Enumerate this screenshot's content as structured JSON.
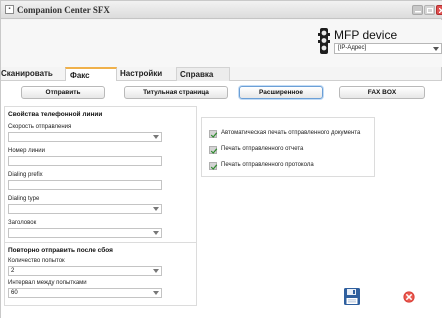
{
  "window": {
    "title": "Companion Center SFX"
  },
  "header": {
    "device_title": "MFP device",
    "ip_select_value": "[IP-Адрес]"
  },
  "tabs": [
    {
      "label": "Сканировать"
    },
    {
      "label": "Факс"
    },
    {
      "label": "Настройки"
    },
    {
      "label": "Справка"
    }
  ],
  "actions": {
    "send": "Отправить",
    "cover_page": "Титульная страница",
    "advanced": "Расширенное",
    "fax_box": "FAX BOX"
  },
  "line_props": {
    "title": "Свойства телефонной линии",
    "speed_label": "Скорость отправления",
    "speed_value": "",
    "line_number_label": "Номер линии",
    "line_number_value": "",
    "dialing_prefix_label": "Dialing prefix",
    "dialing_prefix_value": "",
    "dialing_type_label": "Dialing type",
    "dialing_type_value": "",
    "header_label": "Заголовок",
    "header_value": ""
  },
  "retry": {
    "title": "Повторно отправить после сбоя",
    "attempts_label": "Количество попыток",
    "attempts_value": "2",
    "interval_label": "Интервал между попытками",
    "interval_value": "60"
  },
  "options": [
    {
      "label": "Автоматическая печать отправленного документа",
      "checked": true
    },
    {
      "label": "Печать отправленного отчета",
      "checked": true
    },
    {
      "label": "Печать отправленного протокола",
      "checked": true
    }
  ],
  "icons": {
    "save": "floppy-disk-icon",
    "close": "red-close-icon",
    "device": "traffic-light-icon"
  },
  "colors": {
    "tab_accent": "#f0b14b",
    "button_highlight": "#6b9fd6",
    "close_red": "#d9403a"
  }
}
